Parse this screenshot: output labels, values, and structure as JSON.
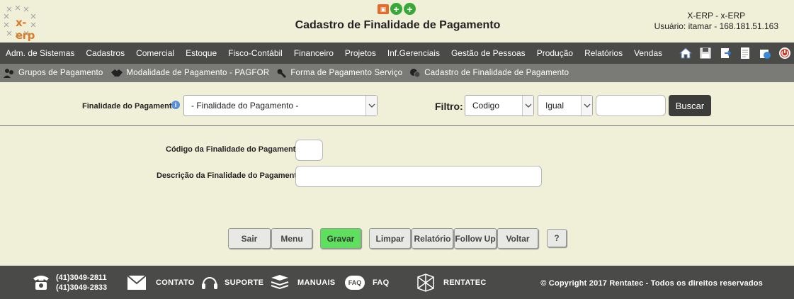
{
  "header": {
    "logo_text": "x-erp",
    "title": "Cadastro de Finalidade de Pagamento",
    "system": "X-ERP - x-ERP",
    "user": "Usuário: itamar - 168.181.51.163",
    "top_icons": [
      "powerpoint-icon",
      "add-icon",
      "add-icon"
    ]
  },
  "menu": {
    "items": [
      "Adm. de Sistemas",
      "Cadastros",
      "Comercial",
      "Estoque",
      "Fisco-Contábil",
      "Financeiro",
      "Projetos",
      "Inf.Gerenciais",
      "Gestão de Pessoas",
      "Produção",
      "Relatórios",
      "Vendas"
    ],
    "icons": [
      "home-icon",
      "save-icon",
      "export-icon",
      "document-icon",
      "stamp-icon",
      "power-icon"
    ]
  },
  "submenu": {
    "items": [
      "Grupos de Pagamento",
      "Modalidade de Pagamento - PAGFOR",
      "Forma de Pagamento Serviço",
      "Cadastro de Finalidade de Pagamento"
    ]
  },
  "filter": {
    "select_label": "Finalidade do Pagamento",
    "select_value": "- Finalidade do Pagamento -",
    "filter_label": "Filtro:",
    "field_value": "Codigo",
    "operator_value": "Igual",
    "search_value": "",
    "search_button": "Buscar"
  },
  "form": {
    "code_label": "Código da Finalidade do Pagamento",
    "code_value": "",
    "desc_label": "Descrição da Finalidade do Pagamento",
    "desc_value": ""
  },
  "actions": {
    "sair": "Sair",
    "menu": "Menu",
    "gravar": "Gravar",
    "limpar": "Limpar",
    "relatorio": "Relatório",
    "follow_up": "Follow Up",
    "voltar": "Voltar",
    "help": "?"
  },
  "footer": {
    "phone1": "(41)3049-2811",
    "phone2": "(41)3049-2833",
    "contato": "CONTATO",
    "suporte": "SUPORTE",
    "manuais": "MANUAIS",
    "faq": "FAQ",
    "faq_icon_text": "FAQ",
    "rentatec": "RENTATEC",
    "copyright": "© Copyright 2017 Rentatec - Todos os direitos reservados"
  },
  "colors": {
    "background": "#f0efd8",
    "menubar": "#4a4a48",
    "submenu": "#7a7a77",
    "gravar": "#5ee05e",
    "logo": "#d87b2a"
  }
}
